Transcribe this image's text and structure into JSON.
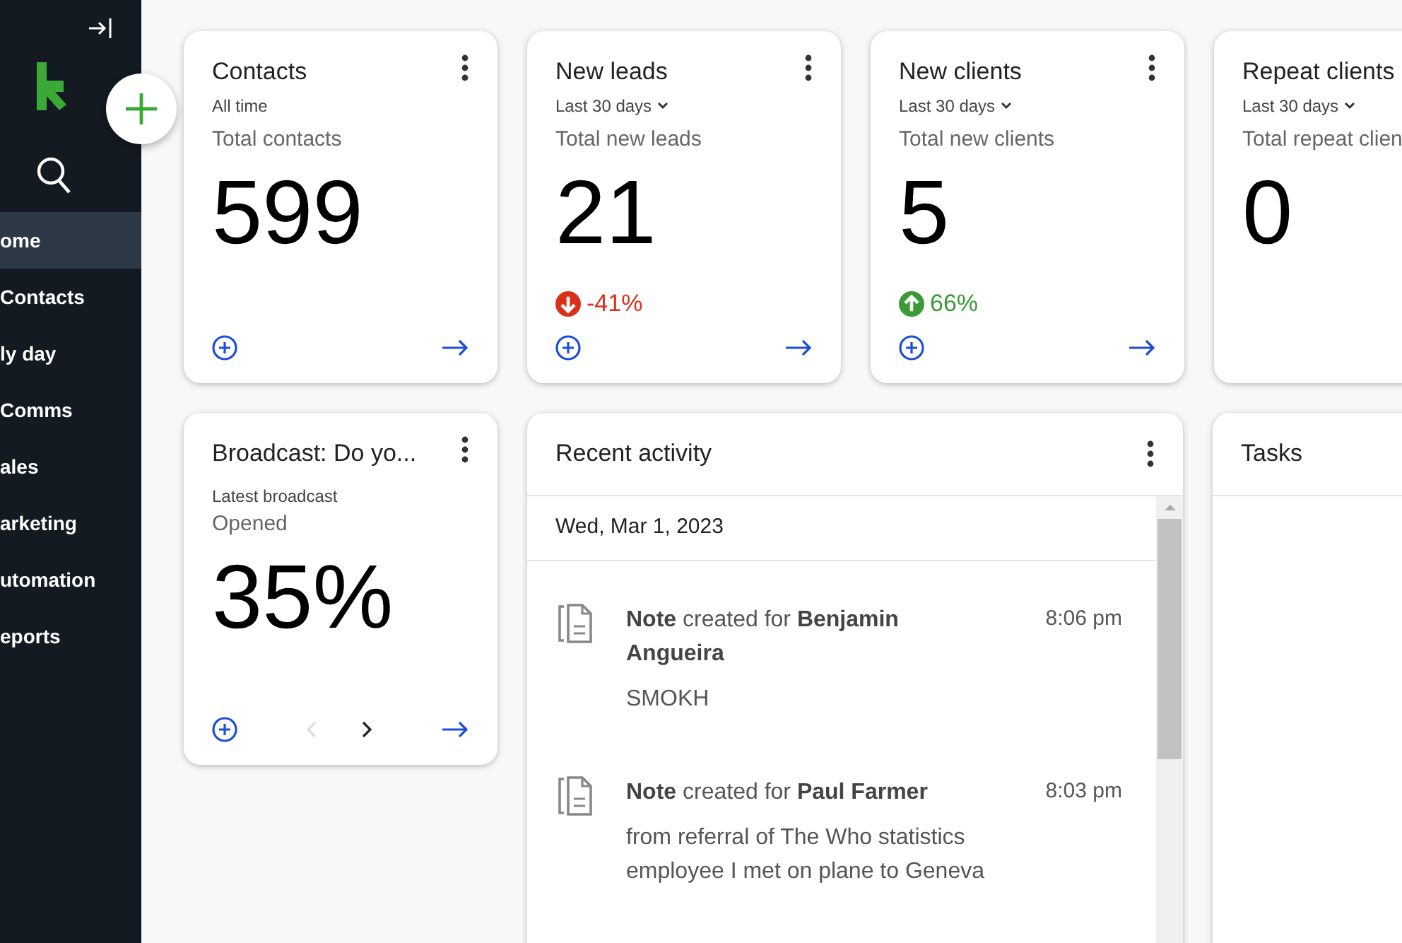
{
  "sidebar": {
    "items": [
      {
        "label": "ome",
        "selected": true
      },
      {
        "label": "Contacts",
        "selected": false
      },
      {
        "label": "ly day",
        "selected": false
      },
      {
        "label": "Comms",
        "selected": false
      },
      {
        "label": "ales",
        "selected": false
      },
      {
        "label": "arketing",
        "selected": false
      },
      {
        "label": "utomation",
        "selected": false
      },
      {
        "label": "eports",
        "selected": false
      }
    ]
  },
  "stat_cards": [
    {
      "title": "Contacts",
      "period": "All time",
      "period_dropdown": false,
      "metric_label": "Total contacts",
      "value": "599",
      "menu": true,
      "footer": true
    },
    {
      "title": "New leads",
      "period": "Last 30 days",
      "period_dropdown": true,
      "metric_label": "Total new leads",
      "value": "21",
      "change": {
        "kind": "down",
        "text": "-41%"
      },
      "menu": true,
      "footer": true
    },
    {
      "title": "New clients",
      "period": "Last 30 days",
      "period_dropdown": true,
      "metric_label": "Total new clients",
      "value": "5",
      "change": {
        "kind": "up",
        "text": "66%"
      },
      "menu": true,
      "footer": true
    },
    {
      "title": "Repeat clients",
      "period": "Last 30 days",
      "period_dropdown": true,
      "metric_label": "Total repeat clien",
      "value": "0",
      "menu": false,
      "footer": false
    }
  ],
  "broadcast_card": {
    "title": "Broadcast: Do yo...",
    "subtitle": "Latest broadcast",
    "metric_label": "Opened",
    "value": "35%",
    "prev_disabled": true,
    "next_disabled": false
  },
  "recent_activity": {
    "title": "Recent activity",
    "date": "Wed, Mar 1, 2023",
    "items": [
      {
        "title": "**Note** created for **Benjamin Angueira**",
        "time": "8:06 pm",
        "body": "SMOKH"
      },
      {
        "title": "**Note** created for **Paul Farmer**",
        "time": "8:03 pm",
        "body": "from referral of The Who statistics employee I met on plane to Geneva"
      }
    ]
  },
  "tasks": {
    "title": "Tasks"
  }
}
